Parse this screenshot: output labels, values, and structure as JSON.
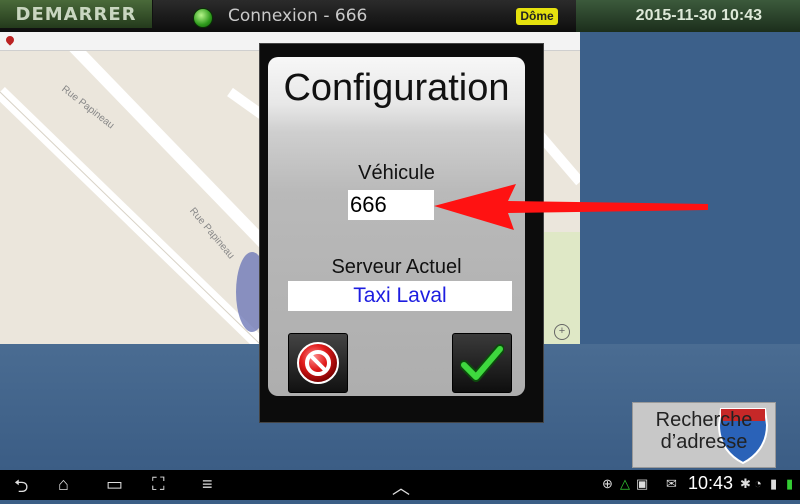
{
  "topbar": {
    "start_label": "DEMARRER",
    "connection_text": "Connexion - 666",
    "dome_badge": "Dôme",
    "datetime": "2015-11-30   10:43"
  },
  "map": {
    "street_1": "Rue Papineau",
    "street_2": "Rue Papineau"
  },
  "dialog": {
    "title": "Configuration",
    "vehicle_label": "Véhicule",
    "vehicle_value": "666",
    "server_label": "Serveur Actuel",
    "server_value": "Taxi Laval"
  },
  "search": {
    "label": "Recherche d’adresse"
  },
  "statusbar": {
    "clock": "10:43"
  },
  "colors": {
    "arrow": "#ff1212",
    "server_text": "#1d1de0",
    "connection_dot": "#2e9a1c",
    "dome_badge": "#e5e10e"
  }
}
